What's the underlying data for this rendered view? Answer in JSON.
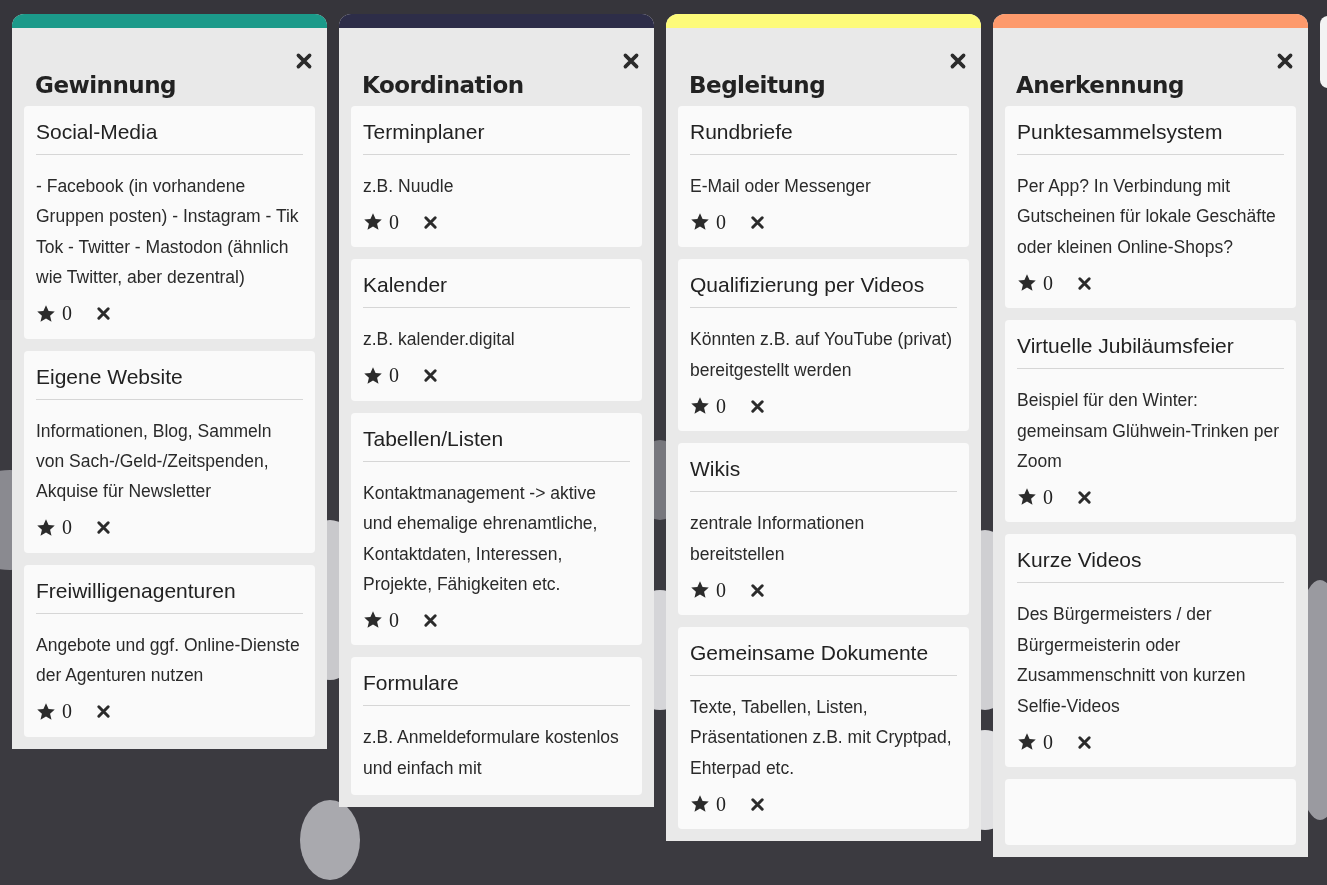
{
  "columns": [
    {
      "kind": "list",
      "title": "Gewinnung",
      "color": "#1b9a8a",
      "cards": [
        {
          "kind": "idea",
          "title": "Social-Media",
          "body": "- Facebook (in vorhandene Gruppen posten) - Instagram - Tik Tok - Twitter - Mastodon (ähnlich wie Twitter, aber dezentral)",
          "votes": "0"
        },
        {
          "kind": "idea",
          "title": "Eigene Website",
          "body": "Informationen, Blog, Sammeln von Sach-/Geld-/Zeitspenden, Akquise für Newsletter",
          "votes": "0"
        },
        {
          "kind": "idea",
          "title": "Freiwilligenagenturen",
          "body": "Angebote und ggf. Online-Dienste der Agenturen nutzen",
          "votes": "0"
        }
      ]
    },
    {
      "kind": "list",
      "title": "Koordination",
      "color": "#2d2d48",
      "cards": [
        {
          "kind": "idea",
          "title": "Terminplaner",
          "body": "z.B. Nuudle",
          "votes": "0"
        },
        {
          "kind": "idea",
          "title": "Kalender",
          "body": "z.B. kalender.digital",
          "votes": "0"
        },
        {
          "kind": "idea",
          "title": "Tabellen/Listen",
          "body": "Kontaktmanagement -> aktive und ehemalige ehrenamtliche, Kontaktdaten, Interessen, Projekte, Fähigkeiten etc.",
          "votes": "0"
        },
        {
          "kind": "cut",
          "title": "Formulare",
          "body": "z.B. Anmeldeformulare kostenlos und einfach mit"
        }
      ]
    },
    {
      "kind": "list",
      "title": "Begleitung",
      "color": "#fdfb7a",
      "cards": [
        {
          "kind": "idea",
          "title": "Rundbriefe",
          "body": "E-Mail oder Messenger",
          "votes": "0"
        },
        {
          "kind": "idea",
          "title": "Qualifizierung per Videos",
          "body": "Könnten z.B. auf YouTube (privat) bereitgestellt werden",
          "votes": "0"
        },
        {
          "kind": "idea",
          "title": "Wikis",
          "body": "zentrale Informationen bereitstellen",
          "votes": "0"
        },
        {
          "kind": "idea",
          "title": "Gemeinsame Dokumente",
          "body": "Texte, Tabellen, Listen, Präsentationen z.B. mit Cryptpad, Ehterpad etc.",
          "votes": "0"
        }
      ]
    },
    {
      "kind": "list",
      "title": "Anerkennung",
      "color": "#fd9a6c",
      "cards": [
        {
          "kind": "idea",
          "title": "Punktesammelsystem",
          "body": "Per App? In Verbindung mit Gutscheinen für lokale Geschäfte oder kleinen Online-Shops?",
          "votes": "0"
        },
        {
          "kind": "idea",
          "title": "Virtuelle Jubiläumsfeier",
          "body": "Beispiel für den Winter: gemeinsam Glühwein-Trinken per Zoom",
          "votes": "0"
        },
        {
          "kind": "idea",
          "title": "Kurze Videos",
          "body": "Des Bürgermeisters / der Bürgermeisterin oder Zusammenschnitt von kurzen Selfie-Videos",
          "votes": "0"
        },
        {
          "kind": "stub"
        }
      ]
    },
    {
      "kind": "stub"
    }
  ]
}
